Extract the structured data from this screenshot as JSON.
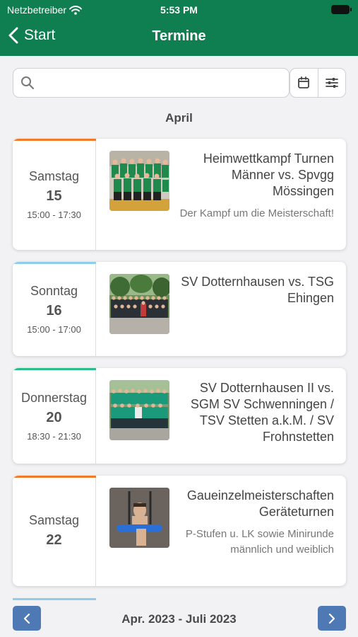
{
  "status": {
    "carrier": "Netzbetreiber",
    "time": "5:53 PM"
  },
  "nav": {
    "back_label": "Start",
    "title": "Termine"
  },
  "search": {
    "placeholder": ""
  },
  "month": "April",
  "events": [
    {
      "weekday": "Samstag",
      "day": "15",
      "time": "15:00 - 17:30",
      "title": "Heimwettkampf Turnen Männer vs. Spvgg Mössingen",
      "subtitle": "Der Kampf um die Meisterschaft!",
      "accent": "#f07b2b"
    },
    {
      "weekday": "Sonntag",
      "day": "16",
      "time": "15:00 - 17:00",
      "title": "SV Dotternhausen vs. TSG Ehingen",
      "subtitle": "",
      "accent": "#8fcdea"
    },
    {
      "weekday": "Donnerstag",
      "day": "20",
      "time": "18:30 - 21:30",
      "title": "SV Dotternhausen II vs. SGM SV Schwenningen / TSV Stetten a.k.M. / SV Frohnstetten",
      "subtitle": "",
      "accent": "#2bbd8a"
    },
    {
      "weekday": "Samstag",
      "day": "22",
      "time": "",
      "title": "Gaueinzelmeisterschaften Geräteturnen",
      "subtitle": "P-Stufen u. LK sowie Minirunde männlich und weiblich",
      "accent": "#f07b2b"
    }
  ],
  "pager": {
    "range": "Apr. 2023 - Juli 2023"
  },
  "colors": {
    "header": "#0f7e50",
    "pager_button": "#4e79b4"
  },
  "icons": {
    "search": "search-icon",
    "calendar": "calendar-icon",
    "filter": "sliders-icon",
    "prev": "chevron-left-icon",
    "next": "chevron-right-icon"
  }
}
